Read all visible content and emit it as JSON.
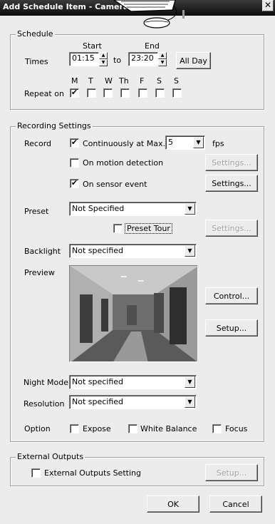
{
  "window": {
    "title": "Add Schedule Item - CameraX",
    "close_glyph": "✕"
  },
  "schedule": {
    "legend": "Schedule",
    "start_label": "Start",
    "end_label": "End",
    "times_label": "Times",
    "start_time": "01:15",
    "to_label": "to",
    "end_time": "23:20",
    "all_day_label": "All Day",
    "repeat_label": "Repeat on",
    "days": [
      {
        "label": "M",
        "checked": true
      },
      {
        "label": "T",
        "checked": false
      },
      {
        "label": "W",
        "checked": false
      },
      {
        "label": "Th",
        "checked": false
      },
      {
        "label": "F",
        "checked": false
      },
      {
        "label": "S",
        "checked": false
      },
      {
        "label": "S",
        "checked": false
      }
    ]
  },
  "recording": {
    "legend": "Recording Settings",
    "record_label": "Record",
    "continuous_label": "Continuously at Max.",
    "continuous_checked": true,
    "fps_value": "5",
    "fps_label": "fps",
    "motion_label": "On motion detection",
    "motion_checked": false,
    "motion_settings_label": "Settings...",
    "sensor_label": "On sensor event",
    "sensor_checked": true,
    "sensor_settings_label": "Settings...",
    "preset_label": "Preset",
    "preset_value": "Not Specified",
    "preset_tour_label": "Preset Tour",
    "preset_tour_checked": false,
    "preset_settings_label": "Settings...",
    "backlight_label": "Backlight",
    "backlight_value": "Not specified",
    "preview_label": "Preview",
    "control_label": "Control...",
    "setup_label": "Setup...",
    "night_mode_label": "Night Mode",
    "night_mode_value": "Not specified",
    "resolution_label": "Resolution",
    "resolution_value": "Not specified",
    "option_label": "Option",
    "expose_label": "Expose",
    "white_balance_label": "White Balance",
    "focus_label": "Focus"
  },
  "external": {
    "legend": "External Outputs",
    "setting_label": "External Outputs Setting",
    "setting_checked": false,
    "setup_label": "Setup..."
  },
  "footer": {
    "ok_label": "OK",
    "cancel_label": "Cancel"
  },
  "icons": {
    "check": "✔",
    "spin_up": "▲",
    "spin_down": "▼",
    "dropdown": "▼"
  }
}
